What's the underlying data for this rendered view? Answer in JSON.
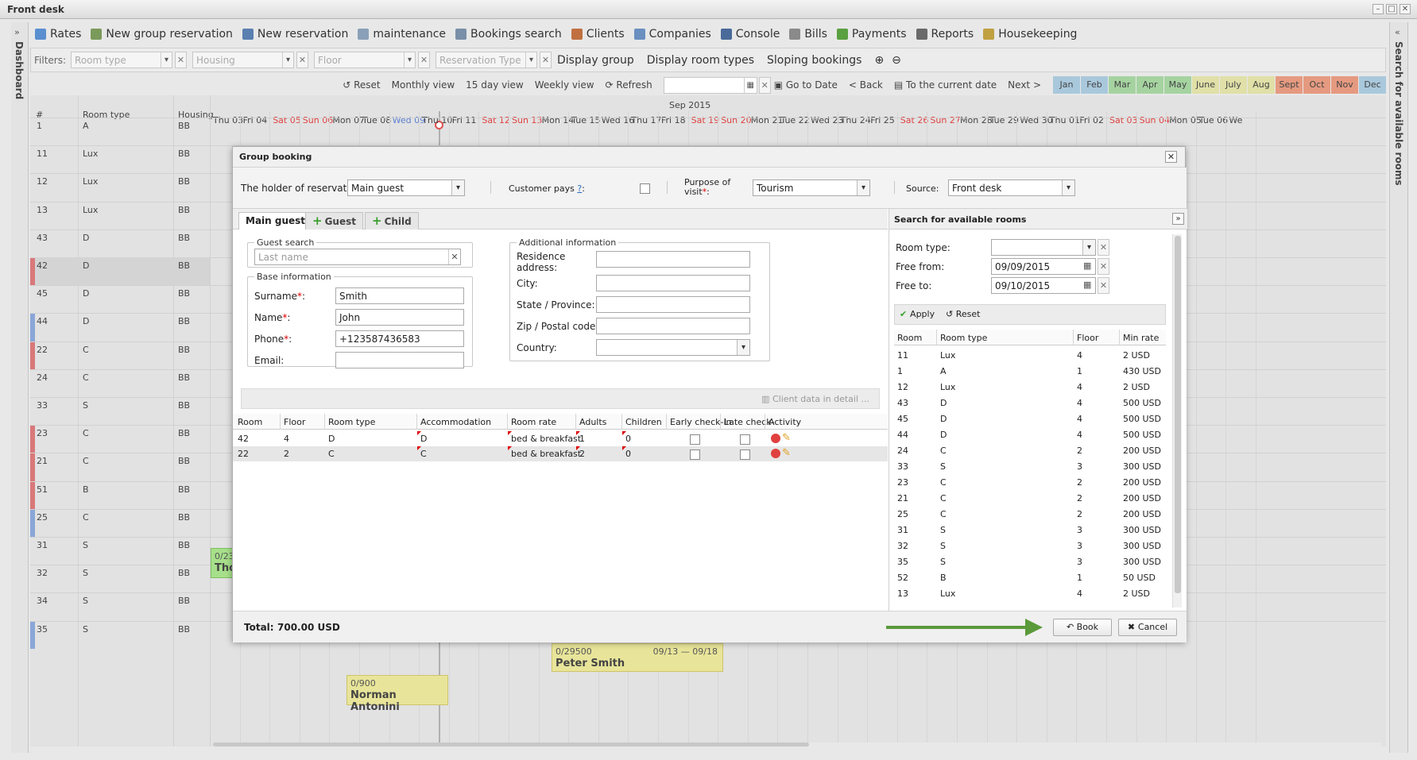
{
  "window": {
    "title": "Front desk"
  },
  "sidebar": {
    "left_label": "Dashboard",
    "right_label": "Search for available rooms"
  },
  "toolbar": [
    {
      "label": "Rates",
      "icon": "chart-icon",
      "color": "#5a8fd0"
    },
    {
      "label": "New group reservation",
      "icon": "group-icon",
      "color": "#7a9a5a"
    },
    {
      "label": "New reservation",
      "icon": "wrench-icon",
      "color": "#5a7fb0"
    },
    {
      "label": "maintenance",
      "icon": "tools-icon",
      "color": "#8aa0b8"
    },
    {
      "label": "Bookings search",
      "icon": "search-icon",
      "color": "#7a8fa8"
    },
    {
      "label": "Clients",
      "icon": "clients-icon",
      "color": "#c07040"
    },
    {
      "label": "Companies",
      "icon": "companies-icon",
      "color": "#6a8fc0"
    },
    {
      "label": "Console",
      "icon": "console-icon",
      "color": "#4a6a9a"
    },
    {
      "label": "Bills",
      "icon": "bills-icon",
      "color": "#8a8a8a"
    },
    {
      "label": "Payments",
      "icon": "payments-icon",
      "color": "#5aa040"
    },
    {
      "label": "Reports",
      "icon": "printer-icon",
      "color": "#6a6a6a"
    },
    {
      "label": "Housekeeping",
      "icon": "broom-icon",
      "color": "#c0a040"
    }
  ],
  "filters": {
    "label": "Filters:",
    "room_type": "Room type",
    "housing": "Housing",
    "floor": "Floor",
    "reservation_type": "Reservation Type",
    "display_group": "Display group",
    "display_room_types": "Display room types",
    "sloping_bookings": "Sloping bookings"
  },
  "nav": {
    "reset": "Reset",
    "monthly": "Monthly view",
    "day15": "15 day view",
    "weekly": "Weekly view",
    "refresh": "Refresh",
    "goto": "Go to Date",
    "back": "< Back",
    "current": "To the current date",
    "next": "Next >",
    "months": [
      {
        "label": "Jan",
        "color": "#a9c8dc"
      },
      {
        "label": "Feb",
        "color": "#a9c8dc"
      },
      {
        "label": "Mar",
        "color": "#a5d3a0"
      },
      {
        "label": "Apr",
        "color": "#a5d3a0"
      },
      {
        "label": "May",
        "color": "#a5d3a0"
      },
      {
        "label": "June",
        "color": "#e0e0a8"
      },
      {
        "label": "July",
        "color": "#e0e0a8"
      },
      {
        "label": "Aug",
        "color": "#e0e0a8"
      },
      {
        "label": "Sept",
        "color": "#e59a80"
      },
      {
        "label": "Oct",
        "color": "#e59a80"
      },
      {
        "label": "Nov",
        "color": "#e59a80"
      },
      {
        "label": "Dec",
        "color": "#a9c8dc"
      }
    ]
  },
  "grid": {
    "month_title": "Sep 2015",
    "col_num": "#",
    "col_room_type": "Room type",
    "col_housing": "Housing",
    "days": [
      {
        "label": "Thu 03",
        "weekend": false
      },
      {
        "label": "Fri 04",
        "weekend": false
      },
      {
        "label": "Sat 05",
        "weekend": true
      },
      {
        "label": "Sun 06",
        "weekend": true
      },
      {
        "label": "Mon 07",
        "weekend": false
      },
      {
        "label": "Tue 08",
        "weekend": false
      },
      {
        "label": "Wed 09",
        "weekend": false
      },
      {
        "label": "Thu 10",
        "weekend": false
      },
      {
        "label": "Fri 11",
        "weekend": false
      },
      {
        "label": "Sat 12",
        "weekend": true
      },
      {
        "label": "Sun 13",
        "weekend": true
      },
      {
        "label": "Mon 14",
        "weekend": false
      },
      {
        "label": "Tue 15",
        "weekend": false
      },
      {
        "label": "Wed 16",
        "weekend": false
      },
      {
        "label": "Thu 17",
        "weekend": false
      },
      {
        "label": "Fri 18",
        "weekend": false
      },
      {
        "label": "Sat 19",
        "weekend": true
      },
      {
        "label": "Sun 20",
        "weekend": true
      },
      {
        "label": "Mon 21",
        "weekend": false
      },
      {
        "label": "Tue 22",
        "weekend": false
      },
      {
        "label": "Wed 23",
        "weekend": false
      },
      {
        "label": "Thu 24",
        "weekend": false
      },
      {
        "label": "Fri 25",
        "weekend": false
      },
      {
        "label": "Sat 26",
        "weekend": true
      },
      {
        "label": "Sun 27",
        "weekend": true
      },
      {
        "label": "Mon 28",
        "weekend": false
      },
      {
        "label": "Tue 29",
        "weekend": false
      },
      {
        "label": "Wed 30",
        "weekend": false
      },
      {
        "label": "Thu 01",
        "weekend": false
      },
      {
        "label": "Fri 02",
        "weekend": false
      },
      {
        "label": "Sat 03",
        "weekend": true
      },
      {
        "label": "Sun 04",
        "weekend": true
      },
      {
        "label": "Mon 05",
        "weekend": false
      },
      {
        "label": "Tue 06",
        "weekend": false
      },
      {
        "label": "We",
        "weekend": false
      }
    ],
    "rows": [
      {
        "num": "1",
        "type": "A",
        "housing": "BB",
        "mark": ""
      },
      {
        "num": "11",
        "type": "Lux",
        "housing": "BB",
        "mark": ""
      },
      {
        "num": "12",
        "type": "Lux",
        "housing": "BB",
        "mark": ""
      },
      {
        "num": "13",
        "type": "Lux",
        "housing": "BB",
        "mark": ""
      },
      {
        "num": "43",
        "type": "D",
        "housing": "BB",
        "mark": ""
      },
      {
        "num": "42",
        "type": "D",
        "housing": "BB",
        "mark": "#d9787a"
      },
      {
        "num": "45",
        "type": "D",
        "housing": "BB",
        "mark": ""
      },
      {
        "num": "44",
        "type": "D",
        "housing": "BB",
        "mark": "#8aa6d8"
      },
      {
        "num": "22",
        "type": "C",
        "housing": "BB",
        "mark": "#d9787a"
      },
      {
        "num": "24",
        "type": "C",
        "housing": "BB",
        "mark": ""
      },
      {
        "num": "33",
        "type": "S",
        "housing": "BB",
        "mark": ""
      },
      {
        "num": "23",
        "type": "C",
        "housing": "BB",
        "mark": "#d9787a"
      },
      {
        "num": "21",
        "type": "C",
        "housing": "BB",
        "mark": "#d9787a"
      },
      {
        "num": "51",
        "type": "B",
        "housing": "BB",
        "mark": "#d9787a"
      },
      {
        "num": "25",
        "type": "C",
        "housing": "BB",
        "mark": "#8aa6d8"
      },
      {
        "num": "31",
        "type": "S",
        "housing": "BB",
        "mark": ""
      },
      {
        "num": "32",
        "type": "S",
        "housing": "BB",
        "mark": ""
      },
      {
        "num": "34",
        "type": "S",
        "housing": "BB",
        "mark": ""
      },
      {
        "num": "35",
        "type": "S",
        "housing": "BB",
        "mark": "#8aa6d8"
      }
    ],
    "bookings": [
      {
        "sum": "0/23",
        "name": "Tho",
        "dates": ""
      },
      {
        "sum": "0/29500",
        "name": "Peter Smith",
        "dates": "09/13 — 09/18"
      },
      {
        "sum": "0/900",
        "name": "Norman Antonini",
        "dates": ""
      }
    ]
  },
  "dialog": {
    "title": "Group booking",
    "holder_label": "The holder of reservation",
    "holder_value": "Main guest",
    "customer_pays_label": "Customer pays",
    "customer_pays_help": "?",
    "purpose_label_1": "Purpose of",
    "purpose_label_2": "visit",
    "purpose_value": "Tourism",
    "source_label": "Source:",
    "source_value": "Front desk",
    "tabs": {
      "main": "Main guest",
      "guest": "Guest",
      "child": "Child"
    },
    "guest_search": {
      "legend": "Guest search",
      "placeholder": "Last name"
    },
    "base_info": {
      "legend": "Base information",
      "surname_label": "Surname",
      "surname": "Smith",
      "name_label": "Name",
      "name": "John",
      "phone_label": "Phone",
      "phone": "+123587436583",
      "email_label": "Email:",
      "email": ""
    },
    "additional_info": {
      "legend": "Additional information",
      "residence_1": "Residence",
      "residence_2": "address:",
      "city": "City:",
      "state": "State / Province:",
      "zip": "Zip / Postal code:",
      "country": "Country:"
    },
    "client_detail": "Client data in detail ...",
    "table": {
      "headers": [
        "Room",
        "Floor",
        "Room type",
        "Accommodation",
        "Room rate",
        "Adults",
        "Children",
        "Early check-in",
        "Late check-",
        "Activity"
      ],
      "rows": [
        {
          "room": "42",
          "floor": "4",
          "type": "D",
          "accommodation": "D",
          "rate": "bed & breakfast",
          "adults": "1",
          "children": "0"
        },
        {
          "room": "22",
          "floor": "2",
          "type": "C",
          "accommodation": "C",
          "rate": "bed & breakfast",
          "adults": "2",
          "children": "0"
        }
      ]
    },
    "total_label": "Total:",
    "total_value": "700.00 USD",
    "book": "Book",
    "cancel": "Cancel",
    "search": {
      "title": "Search for available rooms",
      "room_type_label": "Room type:",
      "free_from_label": "Free from:",
      "free_from": "09/09/2015",
      "free_to_label": "Free to:",
      "free_to": "09/10/2015",
      "apply": "Apply",
      "reset": "Reset",
      "headers": [
        "Room",
        "Room type",
        "Floor",
        "Min rate"
      ],
      "rows": [
        [
          "11",
          "Lux",
          "4",
          "2 USD"
        ],
        [
          "1",
          "A",
          "1",
          "430 USD"
        ],
        [
          "12",
          "Lux",
          "4",
          "2 USD"
        ],
        [
          "43",
          "D",
          "4",
          "500 USD"
        ],
        [
          "45",
          "D",
          "4",
          "500 USD"
        ],
        [
          "44",
          "D",
          "4",
          "500 USD"
        ],
        [
          "24",
          "C",
          "2",
          "200 USD"
        ],
        [
          "33",
          "S",
          "3",
          "300 USD"
        ],
        [
          "23",
          "C",
          "2",
          "200 USD"
        ],
        [
          "21",
          "C",
          "2",
          "200 USD"
        ],
        [
          "25",
          "C",
          "2",
          "200 USD"
        ],
        [
          "31",
          "S",
          "3",
          "300 USD"
        ],
        [
          "32",
          "S",
          "3",
          "300 USD"
        ],
        [
          "35",
          "S",
          "3",
          "300 USD"
        ],
        [
          "52",
          "B",
          "1",
          "50 USD"
        ],
        [
          "13",
          "Lux",
          "4",
          "2 USD"
        ]
      ]
    }
  }
}
